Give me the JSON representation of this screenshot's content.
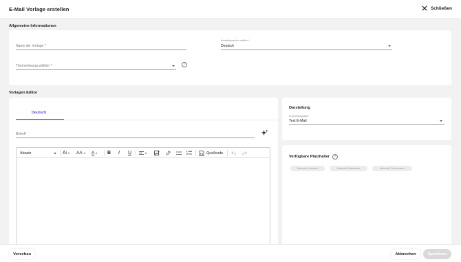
{
  "header": {
    "title": "E-Mail Vorlage erstellen",
    "close_label": "Schließen"
  },
  "general": {
    "section_title": "Allgemeine Informationen",
    "name_placeholder": "Name der Vorlage *",
    "language_label": "Kontaktsprachen wählen *",
    "language_value": "Deutsch",
    "topic_placeholder": "Themenbezug wählen *",
    "help_icon": "?"
  },
  "editor": {
    "section_title": "Vorlagen Editor",
    "tab": "Deutsch",
    "subject_placeholder": "Betreff",
    "toolbar": {
      "block": "Absatz",
      "font_size": "A",
      "font_size_glyph": "AA",
      "color": "A",
      "bold": "B",
      "italic": "I",
      "underline": "U",
      "source": "Quellcode"
    }
  },
  "display": {
    "title": "Darstellung",
    "label": "Erscheinungsbild *",
    "value": "Text E-Mail"
  },
  "placeholders": {
    "title": "Verfügbare Platzhalter",
    "chips": [
      "Absender Vorname",
      "Absender Nachname",
      "Absender Firmenname"
    ]
  },
  "footer": {
    "preview": "Vorschau",
    "cancel": "Abbrechen",
    "save": "Speichern"
  },
  "colors": {
    "accent": "#5b4fd8",
    "background": "#f2f2f2",
    "save_disabled": "#d9d9d9"
  }
}
